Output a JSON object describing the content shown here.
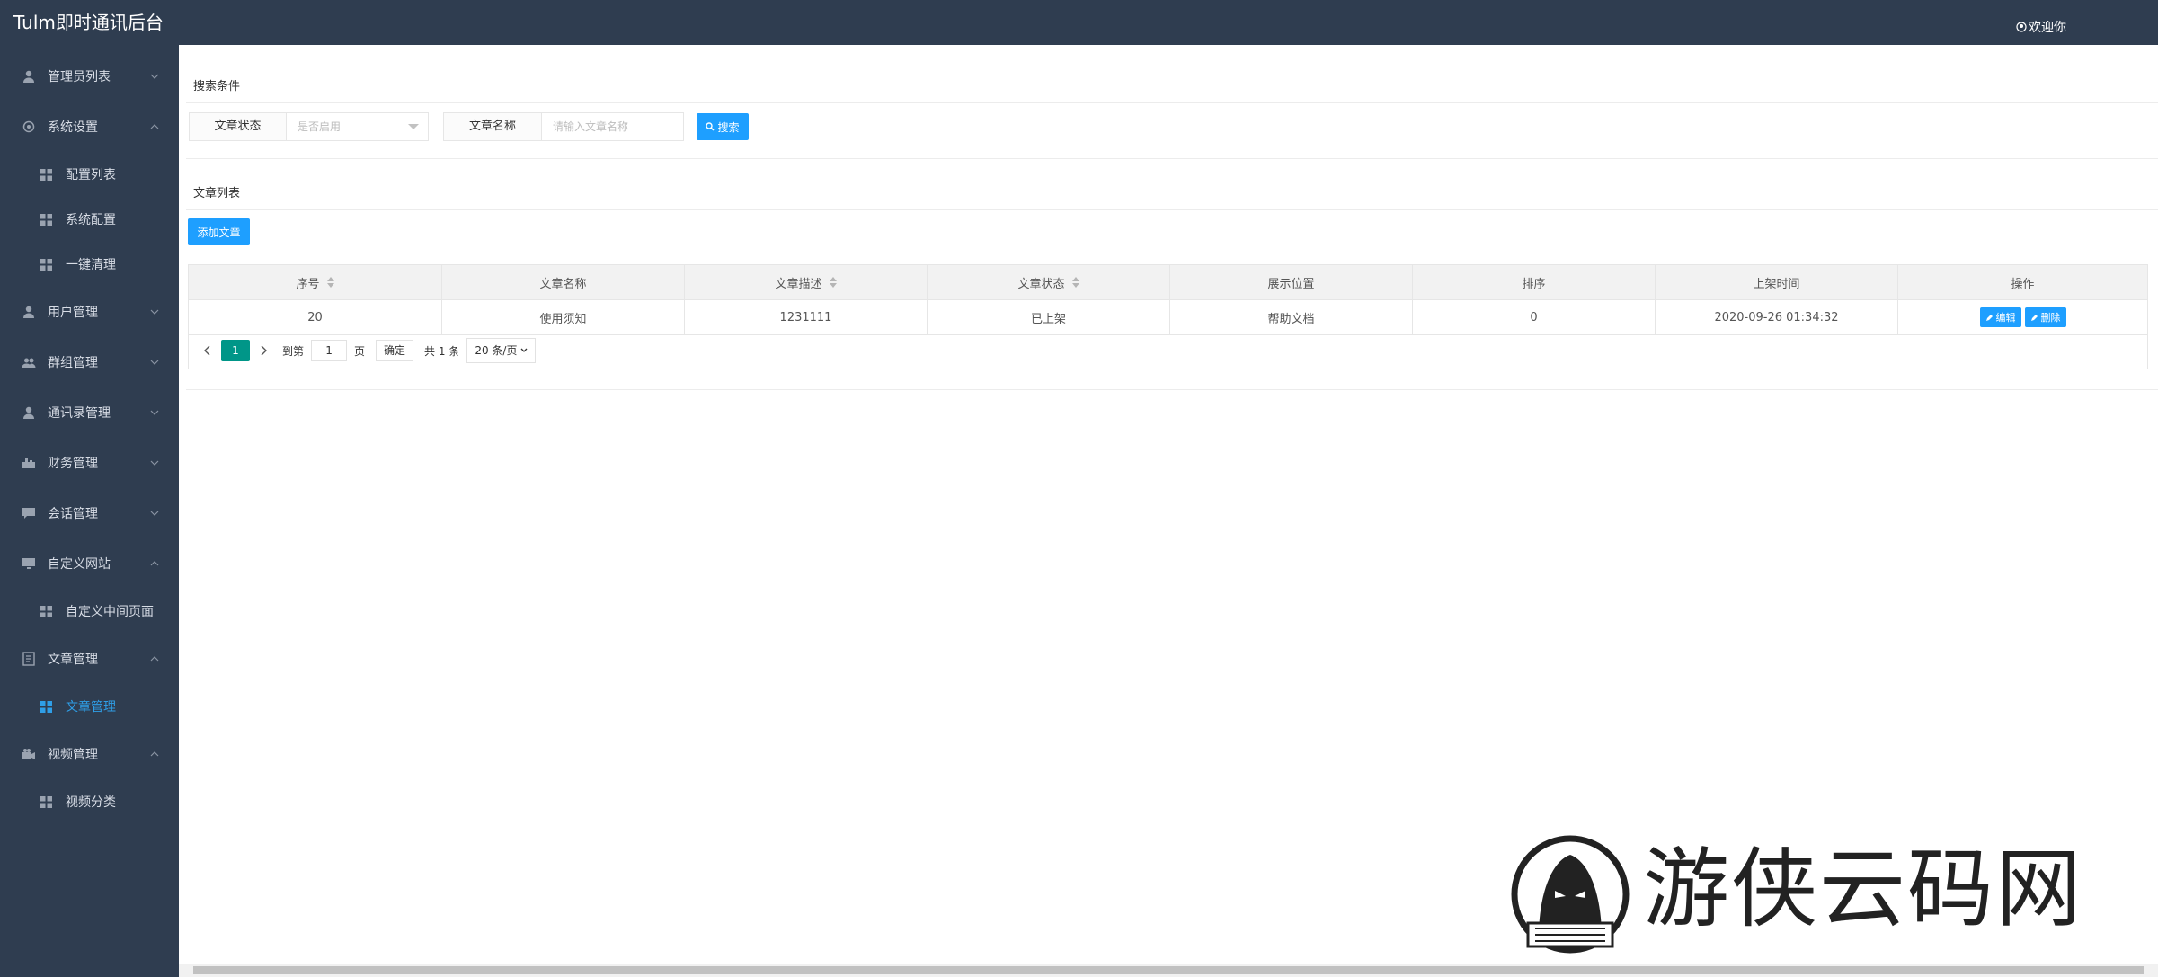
{
  "header": {
    "app_title": "Tulm即时通讯后台",
    "welcome": "欢迎你"
  },
  "sidebar": {
    "items": [
      {
        "label": "管理员列表",
        "icon": "user-icon",
        "chevron": "down"
      },
      {
        "label": "系统设置",
        "icon": "gear-icon",
        "chevron": "up"
      },
      {
        "label": "配置列表",
        "icon": "grid-icon",
        "sub": true
      },
      {
        "label": "系统配置",
        "icon": "grid-icon",
        "sub": true
      },
      {
        "label": "一键清理",
        "icon": "grid-icon",
        "sub": true
      },
      {
        "label": "用户管理",
        "icon": "user-icon",
        "chevron": "down"
      },
      {
        "label": "群组管理",
        "icon": "group-icon",
        "chevron": "down"
      },
      {
        "label": "通讯录管理",
        "icon": "user-icon",
        "chevron": "down"
      },
      {
        "label": "财务管理",
        "icon": "finance-icon",
        "chevron": "down"
      },
      {
        "label": "会话管理",
        "icon": "chat-icon",
        "chevron": "down"
      },
      {
        "label": "自定义网站",
        "icon": "monitor-icon",
        "chevron": "up"
      },
      {
        "label": "自定义中间页面",
        "icon": "grid-icon",
        "sub": true
      },
      {
        "label": "文章管理",
        "icon": "document-icon",
        "chevron": "up"
      },
      {
        "label": "文章管理",
        "icon": "grid-icon",
        "sub": true,
        "active": true
      },
      {
        "label": "视频管理",
        "icon": "video-icon",
        "chevron": "up"
      },
      {
        "label": "视频分类",
        "icon": "grid-icon",
        "sub": true
      }
    ]
  },
  "search": {
    "section_title": "搜索条件",
    "status_label": "文章状态",
    "status_placeholder": "是否启用",
    "name_label": "文章名称",
    "name_placeholder": "请输入文章名称",
    "search_button": "搜索"
  },
  "list": {
    "section_title": "文章列表",
    "add_button": "添加文章"
  },
  "table": {
    "columns": [
      {
        "label": "序号",
        "sortable": true
      },
      {
        "label": "文章名称",
        "sortable": false
      },
      {
        "label": "文章描述",
        "sortable": true
      },
      {
        "label": "文章状态",
        "sortable": true
      },
      {
        "label": "展示位置",
        "sortable": false
      },
      {
        "label": "排序",
        "sortable": false
      },
      {
        "label": "上架时间",
        "sortable": false
      },
      {
        "label": "操作",
        "sortable": false
      }
    ],
    "rows": [
      {
        "id": "20",
        "name": "使用须知",
        "desc": "1231111",
        "status": "已上架",
        "position": "帮助文档",
        "order": "0",
        "time": "2020-09-26 01:34:32"
      }
    ],
    "edit_button": "编辑",
    "delete_button": "删除"
  },
  "pagination": {
    "current_page": "1",
    "goto_label": "到第",
    "goto_value": "1",
    "page_unit": "页",
    "confirm_button": "确定",
    "total_text": "共 1 条",
    "page_size": "20 条/页"
  },
  "watermark": {
    "text": "游侠云码网"
  },
  "colors": {
    "sidebar_bg": "#2f3d50",
    "accent_blue": "#1e9fff",
    "active_link": "#2f9fe8",
    "page_current": "#009688"
  }
}
